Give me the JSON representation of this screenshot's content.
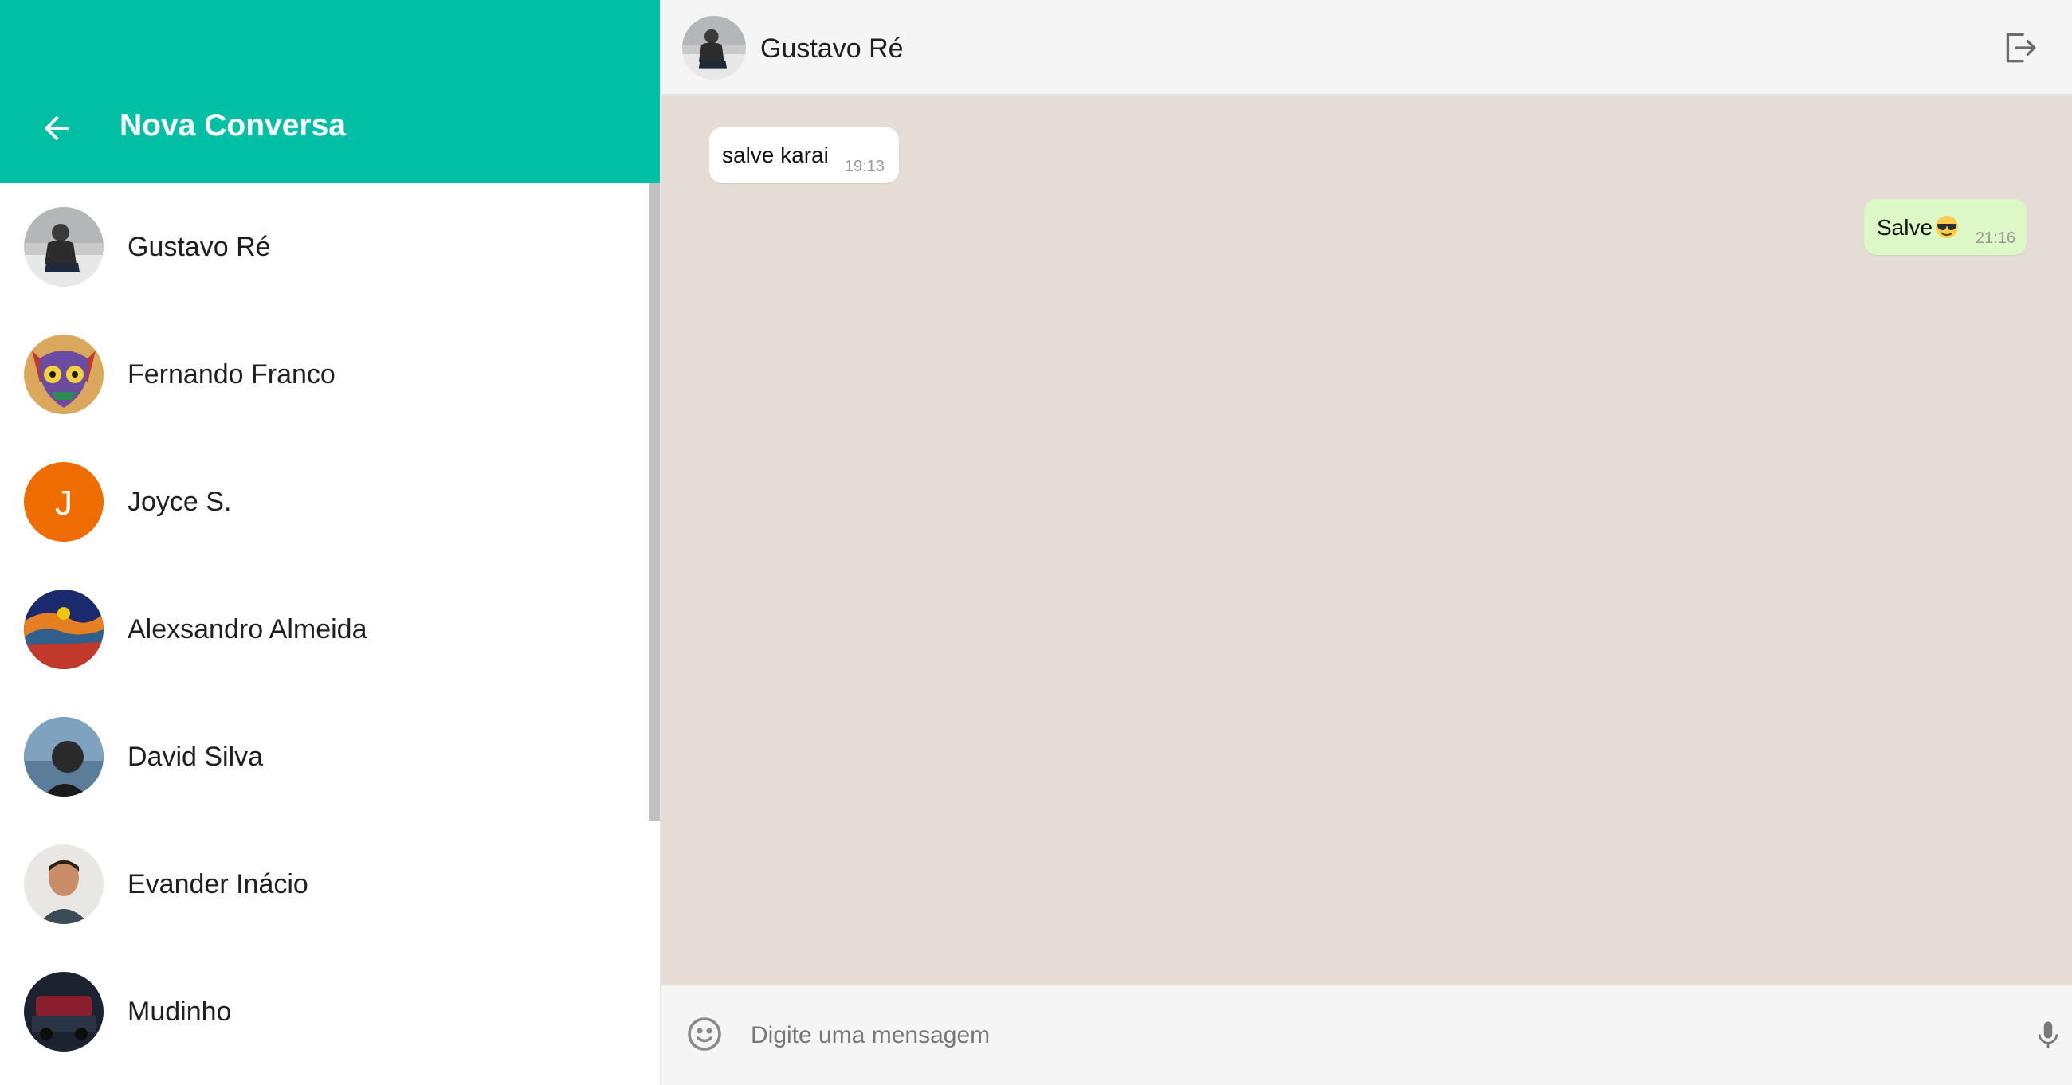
{
  "colors": {
    "brand": "#00bfa5",
    "chat_background": "#e5ddd5",
    "incoming_bubble": "#ffffff",
    "outgoing_bubble": "#dcf8c6",
    "header_background": "#f5f5f5"
  },
  "sidebar": {
    "back_icon": "arrow-left-icon",
    "title": "Nova Conversa",
    "contacts": [
      {
        "name": "Gustavo Ré",
        "avatar": "photo"
      },
      {
        "name": "Fernando Franco",
        "avatar": "mask-artwork"
      },
      {
        "name": "Joyce S.",
        "avatar": "initial",
        "initial": "J",
        "avatar_color": "#ef6c00"
      },
      {
        "name": "Alexsandro Almeida",
        "avatar": "landscape-artwork"
      },
      {
        "name": "David Silva",
        "avatar": "photo"
      },
      {
        "name": "Evander Inácio",
        "avatar": "photo"
      },
      {
        "name": "Mudinho",
        "avatar": "photo"
      }
    ]
  },
  "chat": {
    "contact_name": "Gustavo Ré",
    "logout_icon": "logout-icon",
    "messages": [
      {
        "direction": "incoming",
        "text": "salve karai",
        "time": "19:13"
      },
      {
        "direction": "outgoing",
        "text": "Salve",
        "emoji": "sunglasses-emoji",
        "time": "21:16"
      }
    ],
    "composer": {
      "emoji_icon": "smiley-icon",
      "placeholder": "Digite uma mensagem",
      "value": "",
      "mic_icon": "microphone-icon"
    }
  }
}
